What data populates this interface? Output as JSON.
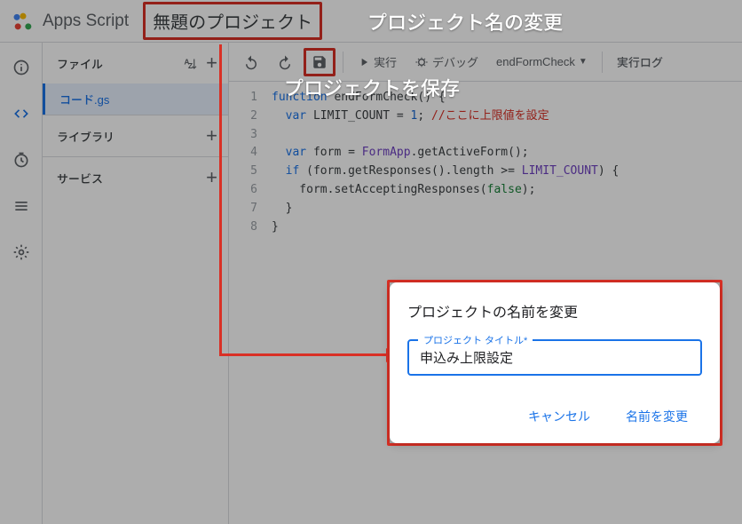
{
  "header": {
    "app_title": "Apps Script",
    "project_name": "無題のプロジェクト"
  },
  "sidebar": {
    "title": "ファイル",
    "file": "コード.gs",
    "libraries": "ライブラリ",
    "services": "サービス"
  },
  "toolbar": {
    "run": "実行",
    "debug": "デバッグ",
    "fn": "endFormCheck",
    "exec_log": "実行ログ"
  },
  "code": {
    "l1a": "function",
    "l1b": " endFormCheck() {",
    "l2a": "var",
    "l2b": " LIMIT_COUNT = ",
    "l2c": "1",
    "l2d": "; ",
    "l2e": "//ここに上限値を設定",
    "l4a": "var",
    "l4b": " form = ",
    "l4c": "FormApp",
    "l4d": ".getActiveForm();",
    "l5a": "if",
    "l5b": " (form.getResponses().length >= ",
    "l5c": "LIMIT_COUNT",
    "l5d": ") {",
    "l6a": "    form.setAcceptingResponses(",
    "l6b": "false",
    "l6c": ");",
    "l7": "  }",
    "l8": "}"
  },
  "dialog": {
    "title": "プロジェクトの名前を変更",
    "field_label": "プロジェクト タイトル*",
    "value": "申込み上限設定",
    "cancel": "キャンセル",
    "rename": "名前を変更"
  },
  "annotations": {
    "rename": "プロジェクト名の変更",
    "save": "プロジェクトを保存"
  }
}
